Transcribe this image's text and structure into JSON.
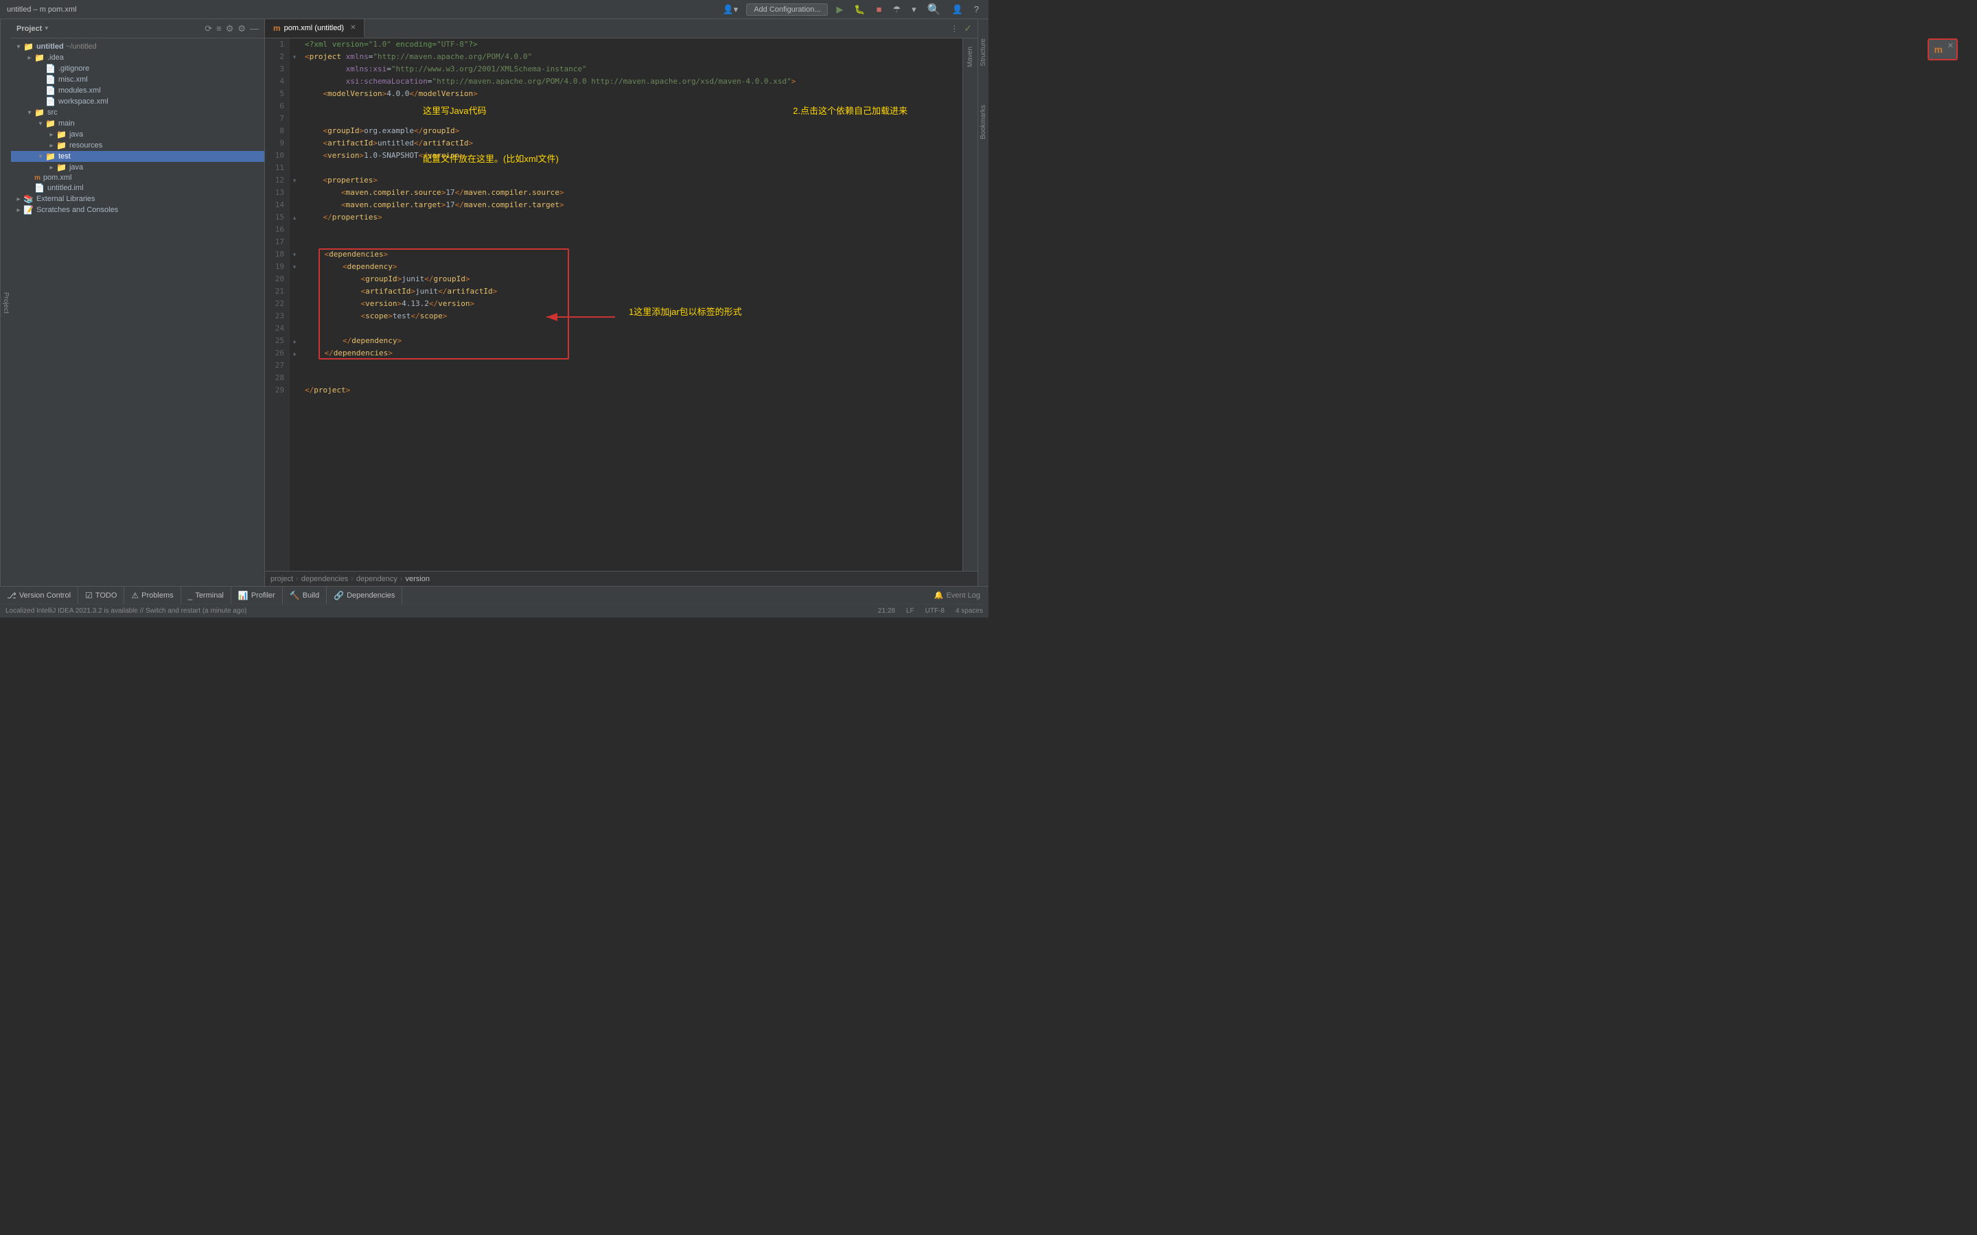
{
  "titleBar": {
    "title": "untitled – m pom.xml",
    "addConfigLabel": "Add Configuration...",
    "icons": [
      "profile-icon",
      "run-icon",
      "debug-icon",
      "stop-icon",
      "settings-icon",
      "search-icon",
      "avatar-icon",
      "help-icon"
    ]
  },
  "sidebar": {
    "title": "Project",
    "tree": [
      {
        "id": "untitled",
        "label": "untitled ~/untitled",
        "icon": "📁",
        "depth": 0,
        "expanded": true
      },
      {
        "id": "idea",
        "label": ".idea",
        "icon": "📁",
        "depth": 1,
        "expanded": false
      },
      {
        "id": "gitignore",
        "label": ".gitignore",
        "icon": "📄",
        "depth": 2,
        "expanded": false
      },
      {
        "id": "misc",
        "label": "misc.xml",
        "icon": "📄",
        "depth": 2,
        "expanded": false
      },
      {
        "id": "modules",
        "label": "modules.xml",
        "icon": "📄",
        "depth": 2,
        "expanded": false
      },
      {
        "id": "workspace",
        "label": "workspace.xml",
        "icon": "📄",
        "depth": 2,
        "expanded": false
      },
      {
        "id": "src",
        "label": "src",
        "icon": "📁",
        "depth": 1,
        "expanded": true
      },
      {
        "id": "main",
        "label": "main",
        "icon": "📁",
        "depth": 2,
        "expanded": true
      },
      {
        "id": "java",
        "label": "java",
        "icon": "📁",
        "depth": 3,
        "expanded": false,
        "color": "blue"
      },
      {
        "id": "resources",
        "label": "resources",
        "icon": "📁",
        "depth": 3,
        "expanded": false
      },
      {
        "id": "test",
        "label": "test",
        "icon": "📁",
        "depth": 2,
        "expanded": true,
        "selected": true
      },
      {
        "id": "java2",
        "label": "java",
        "icon": "📁",
        "depth": 3,
        "expanded": false,
        "color": "yellow"
      },
      {
        "id": "pom",
        "label": "pom.xml",
        "icon": "m",
        "depth": 1,
        "expanded": false
      },
      {
        "id": "untitlediml",
        "label": "untitled.iml",
        "icon": "📄",
        "depth": 1,
        "expanded": false
      },
      {
        "id": "extlibs",
        "label": "External Libraries",
        "icon": "📚",
        "depth": 0,
        "expanded": false
      },
      {
        "id": "scratches",
        "label": "Scratches and Consoles",
        "icon": "📝",
        "depth": 0,
        "expanded": false
      }
    ]
  },
  "editor": {
    "tab": {
      "icon": "m",
      "label": "pom.xml (untitled)",
      "modified": false
    },
    "lines": [
      {
        "num": 1,
        "content": "<?xml version=\"1.0\" encoding=\"UTF-8\"?>",
        "type": "decl"
      },
      {
        "num": 2,
        "content": "<project xmlns=\"http://maven.apache.org/POM/4.0.0\"",
        "type": "tag"
      },
      {
        "num": 3,
        "content": "         xmlns:xsi=\"http://www.w3.org/2001/XMLSchema-instance\"",
        "type": "attr"
      },
      {
        "num": 4,
        "content": "         xsi:schemaLocation=\"http://maven.apache.org/POM/4.0.0 http://maven.apache.org/xsd/maven-4.0.0.xsd\">",
        "type": "attr"
      },
      {
        "num": 5,
        "content": "    <modelVersion>4.0.0</modelVersion>",
        "type": "tag"
      },
      {
        "num": 6,
        "content": "",
        "type": "empty"
      },
      {
        "num": 7,
        "content": "",
        "type": "empty"
      },
      {
        "num": 8,
        "content": "    <groupId>org.example</groupId>",
        "type": "tag"
      },
      {
        "num": 9,
        "content": "    <artifactId>untitled</artifactId>",
        "type": "tag"
      },
      {
        "num": 10,
        "content": "    <version>1.0-SNAPSHOT</version>",
        "type": "tag"
      },
      {
        "num": 11,
        "content": "",
        "type": "empty"
      },
      {
        "num": 12,
        "content": "    <properties>",
        "type": "tag"
      },
      {
        "num": 13,
        "content": "        <maven.compiler.source>17</maven.compiler.source>",
        "type": "tag"
      },
      {
        "num": 14,
        "content": "        <maven.compiler.target>17</maven.compiler.target>",
        "type": "tag"
      },
      {
        "num": 15,
        "content": "    </properties>",
        "type": "tag"
      },
      {
        "num": 16,
        "content": "",
        "type": "empty"
      },
      {
        "num": 17,
        "content": "",
        "type": "empty"
      },
      {
        "num": 18,
        "content": "    <dependencies>",
        "type": "tag",
        "fold": true
      },
      {
        "num": 19,
        "content": "        <dependency>",
        "type": "tag",
        "fold": true
      },
      {
        "num": 20,
        "content": "            <groupId>junit</groupId>",
        "type": "tag"
      },
      {
        "num": 21,
        "content": "            <artifactId>junit</artifactId>",
        "type": "tag"
      },
      {
        "num": 22,
        "content": "            <version>4.13.2</version>",
        "type": "tag",
        "highlighted": true
      },
      {
        "num": 23,
        "content": "            <scope>test</scope>",
        "type": "tag"
      },
      {
        "num": 24,
        "content": "",
        "type": "empty"
      },
      {
        "num": 25,
        "content": "        </dependency>",
        "type": "tag"
      },
      {
        "num": 26,
        "content": "    </dependencies>",
        "type": "tag"
      },
      {
        "num": 27,
        "content": "",
        "type": "empty"
      },
      {
        "num": 28,
        "content": "",
        "type": "empty"
      },
      {
        "num": 29,
        "content": "</project>",
        "type": "tag"
      }
    ]
  },
  "breadcrumb": {
    "items": [
      "project",
      "dependencies",
      "dependency",
      "version"
    ]
  },
  "bottomBar": {
    "buttons": [
      {
        "label": "Version Control",
        "icon": "⎇"
      },
      {
        "label": "TODO",
        "icon": "☑"
      },
      {
        "label": "Problems",
        "icon": "⚠"
      },
      {
        "label": "Terminal",
        "icon": ">_"
      },
      {
        "label": "Profiler",
        "icon": "📊"
      },
      {
        "label": "Build",
        "icon": "🔨"
      },
      {
        "label": "Dependencies",
        "icon": "🔗"
      }
    ],
    "rightItems": [
      {
        "label": "Event Log",
        "icon": "🔔"
      }
    ]
  },
  "statusBar": {
    "message": "Localized IntelliJ IDEA 2021.3.2 is available // Switch and restart (a minute ago)",
    "right": {
      "line": "21:28",
      "encoding": "LF",
      "charset": "UTF-8",
      "spaces": "4 spaces"
    }
  },
  "annotations": {
    "javaCode": "这里写Java代码",
    "configFiles": "配置文件放在这里。(比如xml文件)",
    "addJar": "1这里添加jar包以标签的形式",
    "clickDep": "2.点击这个依赖自己加载进来"
  },
  "mavenPopup": {
    "icon": "m",
    "closeIcon": "✕"
  }
}
